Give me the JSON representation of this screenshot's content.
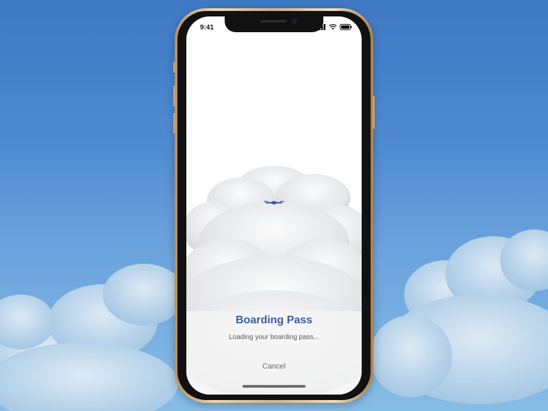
{
  "status_bar": {
    "time": "9:41"
  },
  "content": {
    "title": "Boarding Pass",
    "subtitle": "Loading your boarding pass...",
    "cancel_label": "Cancel"
  },
  "icons": {
    "signal": "cellular-signal-icon",
    "wifi": "wifi-icon",
    "battery": "battery-icon",
    "plane": "airplane-icon"
  },
  "colors": {
    "sky": "#4f8ad1",
    "title": "#3c5aa7",
    "phone_frame": "#d6b184"
  }
}
